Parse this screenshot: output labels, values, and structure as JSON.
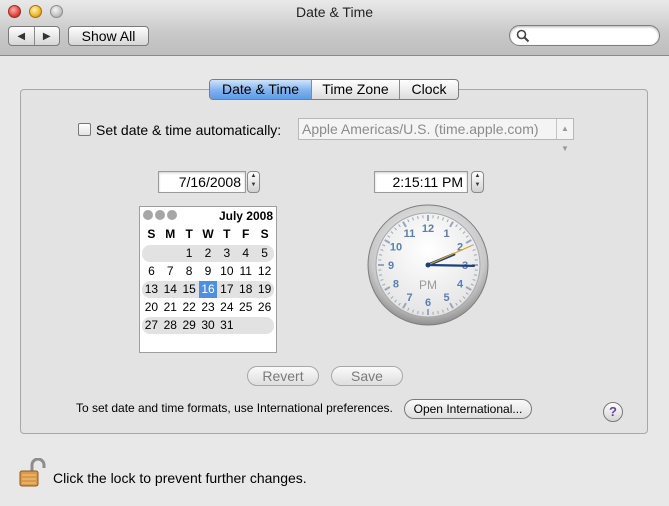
{
  "window": {
    "title": "Date & Time"
  },
  "toolbar": {
    "back_icon": "◀",
    "forward_icon": "▶",
    "show_all_label": "Show All",
    "search_placeholder": ""
  },
  "tabs": [
    {
      "label": "Date & Time",
      "selected": true
    },
    {
      "label": "Time Zone",
      "selected": false
    },
    {
      "label": "Clock",
      "selected": false
    }
  ],
  "auto": {
    "checkbox_label": "Set date & time automatically:",
    "checked": false,
    "server": "Apple Americas/U.S. (time.apple.com)"
  },
  "date_field": {
    "value": "7/16/2008"
  },
  "time_field": {
    "value": "2:15:11 PM"
  },
  "calendar": {
    "month_label": "July 2008",
    "weekdays": [
      "S",
      "M",
      "T",
      "W",
      "T",
      "F",
      "S"
    ],
    "weeks": [
      [
        "",
        "",
        "1",
        "2",
        "3",
        "4",
        "5"
      ],
      [
        "6",
        "7",
        "8",
        "9",
        "10",
        "11",
        "12"
      ],
      [
        "13",
        "14",
        "15",
        "16",
        "17",
        "18",
        "19"
      ],
      [
        "20",
        "21",
        "22",
        "23",
        "24",
        "25",
        "26"
      ],
      [
        "27",
        "28",
        "29",
        "30",
        "31",
        "",
        ""
      ]
    ],
    "selected_day": "16"
  },
  "clock": {
    "numbers": [
      "12",
      "1",
      "2",
      "3",
      "4",
      "5",
      "6",
      "7",
      "8",
      "9",
      "10",
      "11"
    ],
    "ampm": "PM",
    "hour": 2,
    "minute": 15,
    "second": 11,
    "hand_color": "#1f3f7a",
    "second_hand_color": "#e0a020"
  },
  "buttons": {
    "revert": "Revert",
    "save": "Save",
    "open_international": "Open International..."
  },
  "info_text": "To set date and time formats, use International preferences.",
  "help_label": "?",
  "lock": {
    "text": "Click the lock to prevent further changes."
  },
  "colors": {
    "accent": "#4f8fdc",
    "tab_selected": "#7fb2ee"
  }
}
